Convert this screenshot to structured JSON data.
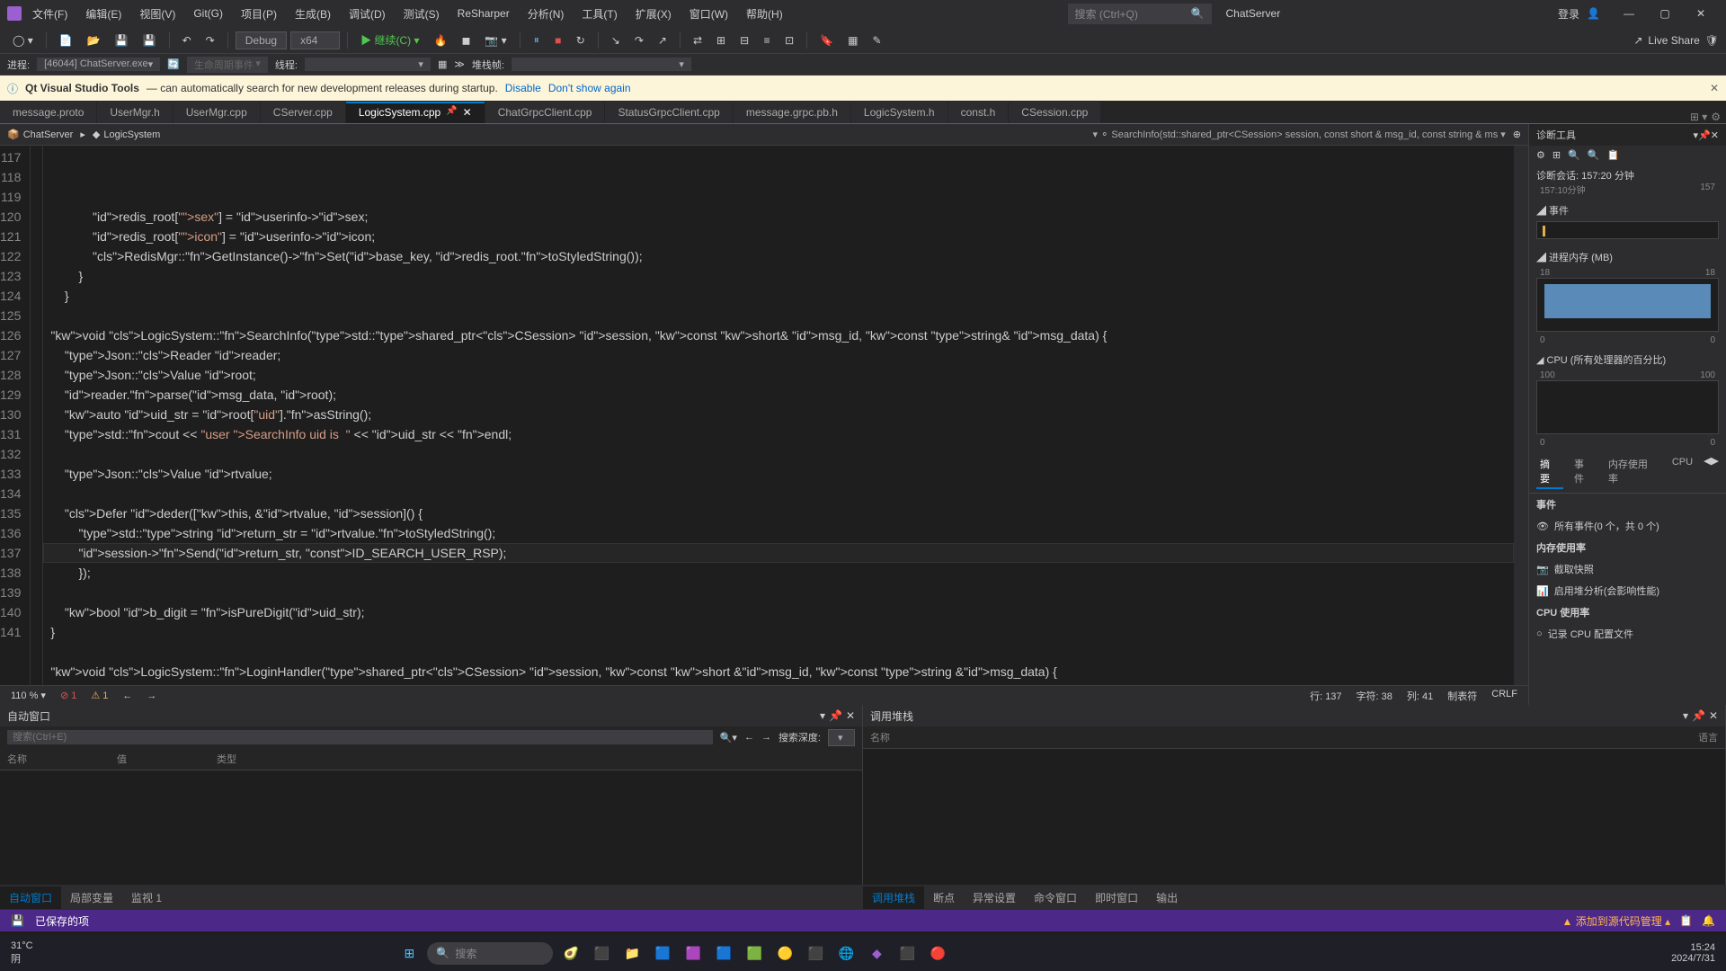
{
  "titlebar": {
    "menus": [
      "文件(F)",
      "编辑(E)",
      "视图(V)",
      "Git(G)",
      "项目(P)",
      "生成(B)",
      "调试(D)",
      "测试(S)",
      "ReSharper",
      "分析(N)",
      "工具(T)",
      "扩展(X)",
      "窗口(W)",
      "帮助(H)"
    ],
    "search_placeholder": "搜索 (Ctrl+Q)",
    "project_name": "ChatServer",
    "login": "登录"
  },
  "toolbar": {
    "config": "Debug",
    "platform": "x64",
    "continue": "继续(C)",
    "liveshare": "Live Share"
  },
  "process": {
    "label": "进程:",
    "value": "[46044] ChatServer.exe",
    "lifecycle_label": "生命周期事件",
    "thread_label": "线程:",
    "stackframe_label": "堆栈帧:"
  },
  "info": {
    "tool": "Qt Visual Studio Tools",
    "msg": "— can automatically search for new development releases during startup.",
    "disable": "Disable",
    "dont_show": "Don't show again"
  },
  "tabs": [
    "message.proto",
    "UserMgr.h",
    "UserMgr.cpp",
    "CServer.cpp",
    "LogicSystem.cpp",
    "ChatGrpcClient.cpp",
    "StatusGrpcClient.cpp",
    "message.grpc.pb.h",
    "LogicSystem.h",
    "const.h",
    "CSession.cpp"
  ],
  "active_tab_index": 4,
  "nav": {
    "scope": "ChatServer",
    "cls": "LogicSystem",
    "sig": "SearchInfo(std::shared_ptr<CSession> session, const short & msg_id, const string & ms"
  },
  "editor": {
    "first_line": 117,
    "lines": [
      {
        "n": 117,
        "t": "            redis_root[\"sex\"] = userinfo->sex;"
      },
      {
        "n": 118,
        "t": "            redis_root[\"icon\"] = userinfo->icon;"
      },
      {
        "n": 119,
        "t": "            RedisMgr::GetInstance()->Set(base_key, redis_root.toStyledString());"
      },
      {
        "n": 120,
        "t": "        }"
      },
      {
        "n": 121,
        "t": "    }"
      },
      {
        "n": 122,
        "t": ""
      },
      {
        "n": 123,
        "t": "void LogicSystem::SearchInfo(std::shared_ptr<CSession> session, const short& msg_id, const string& msg_data) {"
      },
      {
        "n": 124,
        "t": "    Json::Reader reader;"
      },
      {
        "n": 125,
        "t": "    Json::Value root;"
      },
      {
        "n": 126,
        "t": "    reader.parse(msg_data, root);"
      },
      {
        "n": 127,
        "t": "    auto uid_str = root[\"uid\"].asString();"
      },
      {
        "n": 128,
        "t": "    std::cout << \"user SearchInfo uid is  \" << uid_str << endl;"
      },
      {
        "n": 129,
        "t": ""
      },
      {
        "n": 130,
        "t": "    Json::Value rtvalue;"
      },
      {
        "n": 131,
        "t": ""
      },
      {
        "n": 132,
        "t": "    Defer deder([this, &rtvalue, session]() {"
      },
      {
        "n": 133,
        "t": "        std::string return_str = rtvalue.toStyledString();"
      },
      {
        "n": 134,
        "t": "        session->Send(return_str, ID_SEARCH_USER_RSP);"
      },
      {
        "n": 135,
        "t": "        });"
      },
      {
        "n": 136,
        "t": ""
      },
      {
        "n": 137,
        "t": "    bool b_digit = isPureDigit(uid_str);"
      },
      {
        "n": 138,
        "t": "}"
      },
      {
        "n": 139,
        "t": ""
      },
      {
        "n": 140,
        "t": "void LogicSystem::LoginHandler(shared_ptr<CSession> session, const short &msg_id, const string &msg_data) {"
      },
      {
        "n": 141,
        "t": "    Json::Reader reader;"
      }
    ],
    "highlight_line": 137
  },
  "editor_status": {
    "zoom": "110 %",
    "errors": "1",
    "warnings": "1",
    "line": "行: 137",
    "char": "字符: 38",
    "col": "列: 41",
    "tabs": "制表符",
    "eol": "CRLF"
  },
  "diag": {
    "title": "诊断工具",
    "session": "诊断会话: 157:20 分钟",
    "time_start": "157:10分钟",
    "time_end": "157",
    "events_title": "◢ 事件",
    "memory_title": "◢ 进程内存 (MB)",
    "memory_max": "18",
    "memory_min": "0",
    "cpu_title": "◢ CPU (所有处理器的百分比)",
    "cpu_max": "100",
    "cpu_min": "0",
    "tabs": [
      "摘要",
      "事件",
      "内存使用率",
      "CPU"
    ],
    "events_section": "事件",
    "events_all": "所有事件(0 个，共 0 个)",
    "mem_section": "内存使用率",
    "snapshot": "截取快照",
    "heap": "启用堆分析(会影响性能)",
    "cpu_section": "CPU 使用率",
    "cpu_record": "记录 CPU 配置文件"
  },
  "bottom": {
    "left_title": "自动窗口",
    "search_placeholder": "搜索(Ctrl+E)",
    "depth_label": "搜索深度:",
    "col_name": "名称",
    "col_value": "值",
    "col_type": "类型",
    "right_title": "调用堆栈",
    "col_name2": "名称",
    "col_lang": "语言",
    "left_tabs": [
      "自动窗口",
      "局部变量",
      "监视 1"
    ],
    "right_tabs": [
      "调用堆栈",
      "断点",
      "异常设置",
      "命令窗口",
      "即时窗口",
      "输出"
    ]
  },
  "status": {
    "saved": "已保存的项",
    "git": "添加到源代码管理",
    "arrow": "▲"
  },
  "taskbar": {
    "temp": "31°C",
    "weather": "阴",
    "search": "搜索",
    "time": "15:24",
    "date": "2024/7/31"
  }
}
